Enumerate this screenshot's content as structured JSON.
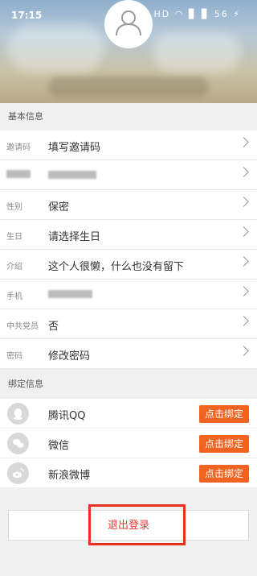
{
  "status_bar": {
    "time": "17:15",
    "icons": "✱ HD ◠ ▊ ▊ 56 ⚡"
  },
  "sections": {
    "basic": "基本信息",
    "binding": "绑定信息"
  },
  "basic_rows": [
    {
      "label": "邀请码",
      "value": "填写邀请码"
    },
    {
      "label": "",
      "value": ""
    },
    {
      "label": "性别",
      "value": "保密"
    },
    {
      "label": "生日",
      "value": "请选择生日"
    },
    {
      "label": "介绍",
      "value": "这个人很懒，什么也没有留下"
    },
    {
      "label": "手机",
      "value": ""
    },
    {
      "label": "中共党员",
      "value": "否"
    },
    {
      "label": "密码",
      "value": "修改密码"
    }
  ],
  "binding_rows": [
    {
      "icon": "qq-icon",
      "value": "腾讯QQ",
      "button": "点击绑定"
    },
    {
      "icon": "wechat-icon",
      "value": "微信",
      "button": "点击绑定"
    },
    {
      "icon": "weibo-icon",
      "value": "新浪微博",
      "button": "点击绑定"
    }
  ],
  "logout_label": "退出登录",
  "colors": {
    "accent": "#f06321",
    "logout_text": "#e53935",
    "highlight_box": "#e8321f"
  }
}
